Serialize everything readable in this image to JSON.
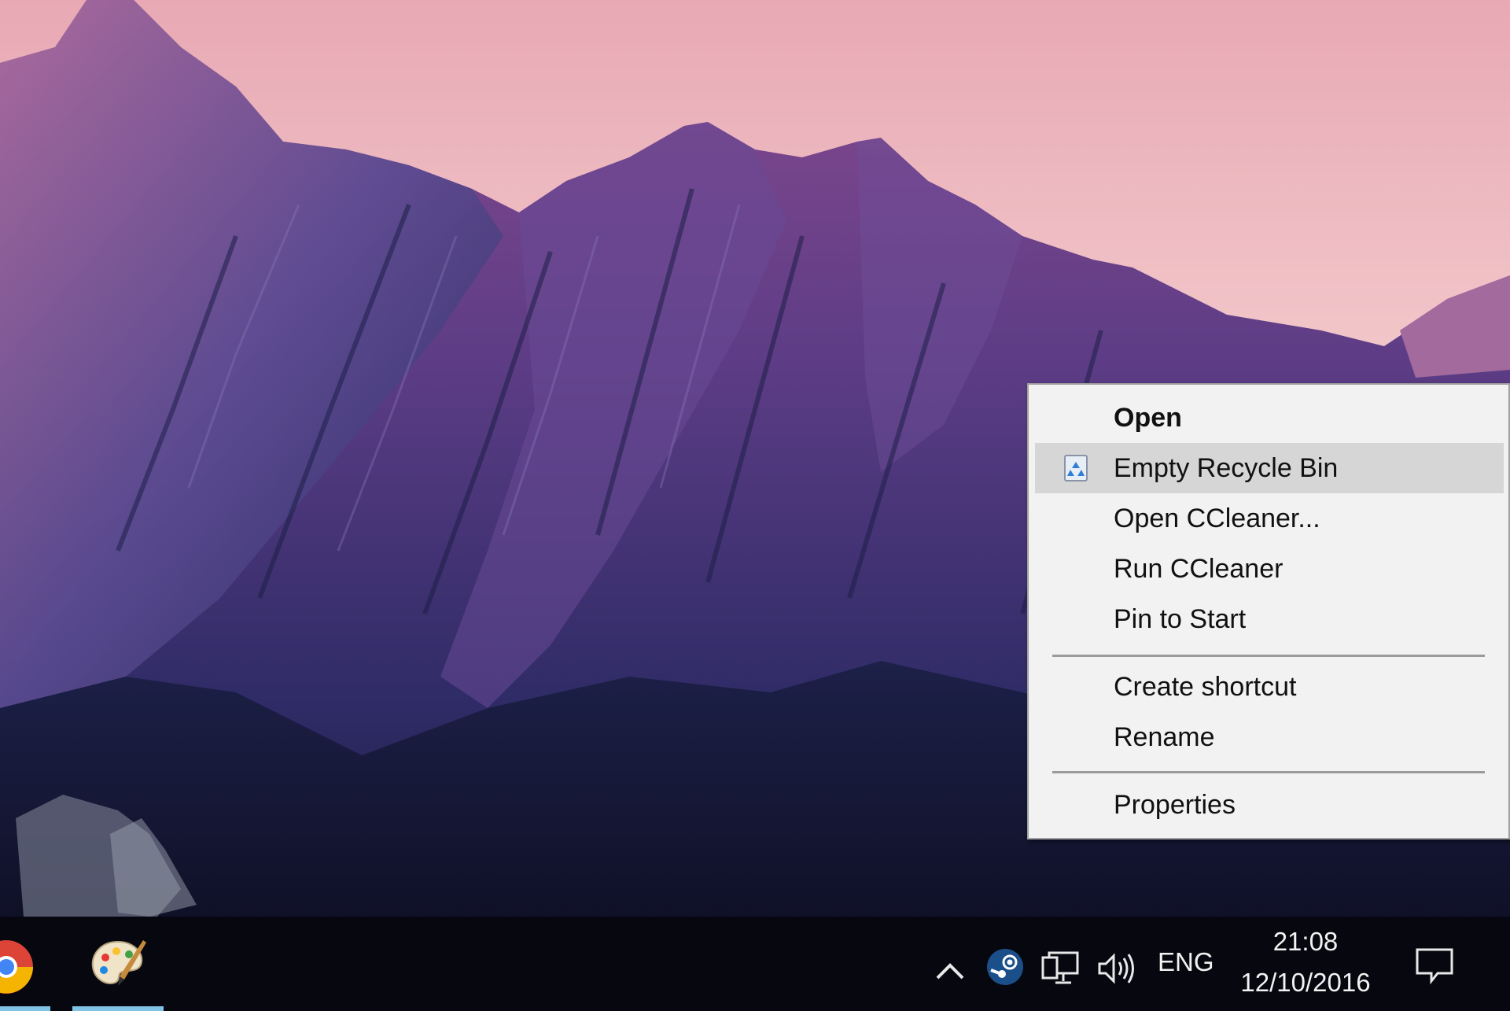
{
  "context_menu": {
    "items": [
      {
        "label": "Open",
        "bold": true
      },
      {
        "label": "Empty Recycle Bin",
        "icon": "recycle-bin-icon",
        "highlighted": true
      },
      {
        "label": "Open CCleaner..."
      },
      {
        "label": "Run CCleaner"
      },
      {
        "label": "Pin to Start"
      },
      {
        "label": "Create shortcut"
      },
      {
        "label": "Rename"
      },
      {
        "label": "Properties"
      }
    ]
  },
  "taskbar": {
    "pinned_apps": [
      {
        "name": "chrome",
        "icon": "chrome-icon"
      },
      {
        "name": "paint",
        "icon": "paint-palette-icon"
      }
    ],
    "tray": {
      "icons": [
        "show-hidden-icons-chevron-icon",
        "steam-icon",
        "network-icon",
        "volume-icon"
      ],
      "language": "ENG",
      "time": "21:08",
      "date": "12/10/2016",
      "notification_icon": "action-center-icon"
    }
  },
  "colors": {
    "menu_background": "#f2f2f2",
    "menu_highlight": "#d6d6d6",
    "taskbar_background": "#07080f",
    "active_indicator": "#7fc4e6"
  }
}
